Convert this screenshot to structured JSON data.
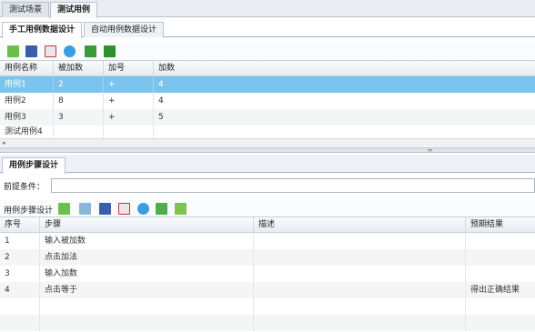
{
  "top_tabs": [
    "测试场景",
    "测试用例"
  ],
  "sub_tabs": [
    "手工用例数据设计",
    "自动用例数据设计"
  ],
  "case_grid": {
    "columns": [
      "用例名称",
      "被加数",
      "加号",
      "加数"
    ],
    "rows": [
      [
        "用例1",
        "2",
        "+",
        "4"
      ],
      [
        "用例2",
        "8",
        "+",
        "4"
      ],
      [
        "用例3",
        "3",
        "+",
        "5"
      ],
      [
        "测试用例4",
        "",
        "",
        ""
      ]
    ]
  },
  "steps_panel": {
    "tab": "用例步骤设计",
    "precondition_label": "前提条件：",
    "precondition_value": "",
    "toolbar_title": "用例步骤设计"
  },
  "steps_grid": {
    "columns": [
      "序号",
      "步骤",
      "描述",
      "预期结果"
    ],
    "rows": [
      [
        "1",
        "输入被加数",
        "",
        ""
      ],
      [
        "2",
        "点击加法",
        "",
        ""
      ],
      [
        "3",
        "输入加数",
        "",
        ""
      ],
      [
        "4",
        "点击等于",
        "",
        "得出正确结果"
      ]
    ]
  },
  "colors": {
    "selected_row": "#7cc4ee",
    "tab_border": "#9fb3c9"
  },
  "icons": [
    "add-icon",
    "save-icon",
    "delete-icon",
    "refresh-icon",
    "export-icon",
    "import-icon",
    "up-arrow-icon",
    "down-arrow-icon"
  ]
}
